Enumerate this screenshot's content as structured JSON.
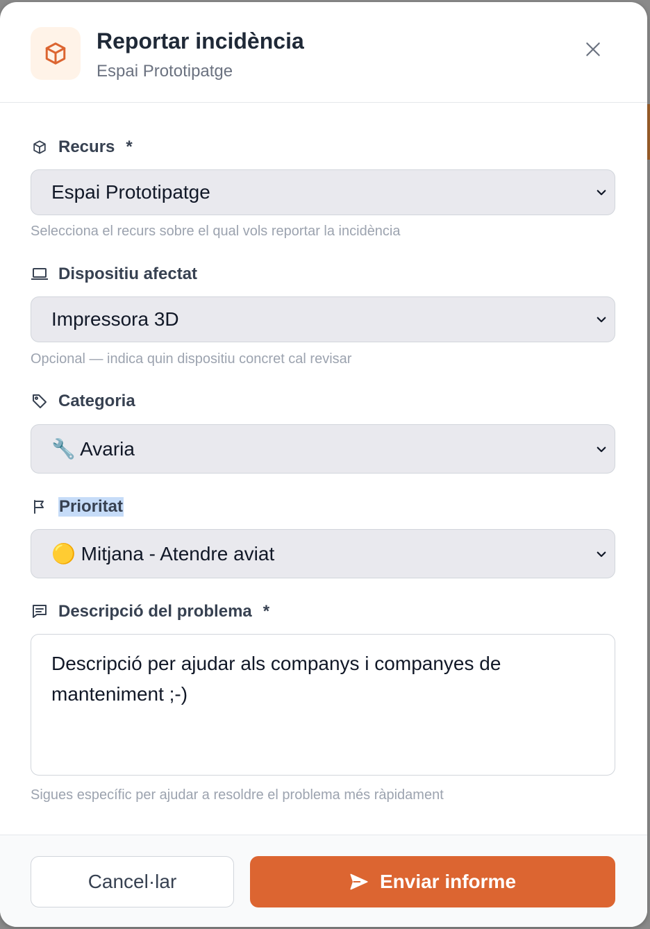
{
  "header": {
    "title": "Reportar incidència",
    "subtitle": "Espai Prototipatge",
    "accent": "#dc6531"
  },
  "form": {
    "resource": {
      "label": "Recurs",
      "required_mark": "*",
      "value": "Espai Prototipatge",
      "hint": "Selecciona el recurs sobre el qual vols reportar la incidència",
      "icon": "cube-icon"
    },
    "device": {
      "label": "Dispositiu afectat",
      "value": "Impressora 3D",
      "hint": "Opcional — indica quin dispositiu concret cal revisar",
      "icon": "laptop-icon"
    },
    "category": {
      "label": "Categoria",
      "value": "🔧 Avaria",
      "icon": "tag-icon"
    },
    "priority": {
      "label": "Prioritat",
      "value": "🟡 Mitjana - Atendre aviat",
      "icon": "flag-icon"
    },
    "description": {
      "label": "Descripció del problema",
      "required_mark": "*",
      "value": "Descripció per ajudar als companys i companyes de manteniment ;-)",
      "hint": "Sigues específic per ajudar a resoldre el problema més ràpidament",
      "icon": "message-icon"
    }
  },
  "footer": {
    "cancel_label": "Cancel·lar",
    "submit_label": "Enviar informe"
  }
}
